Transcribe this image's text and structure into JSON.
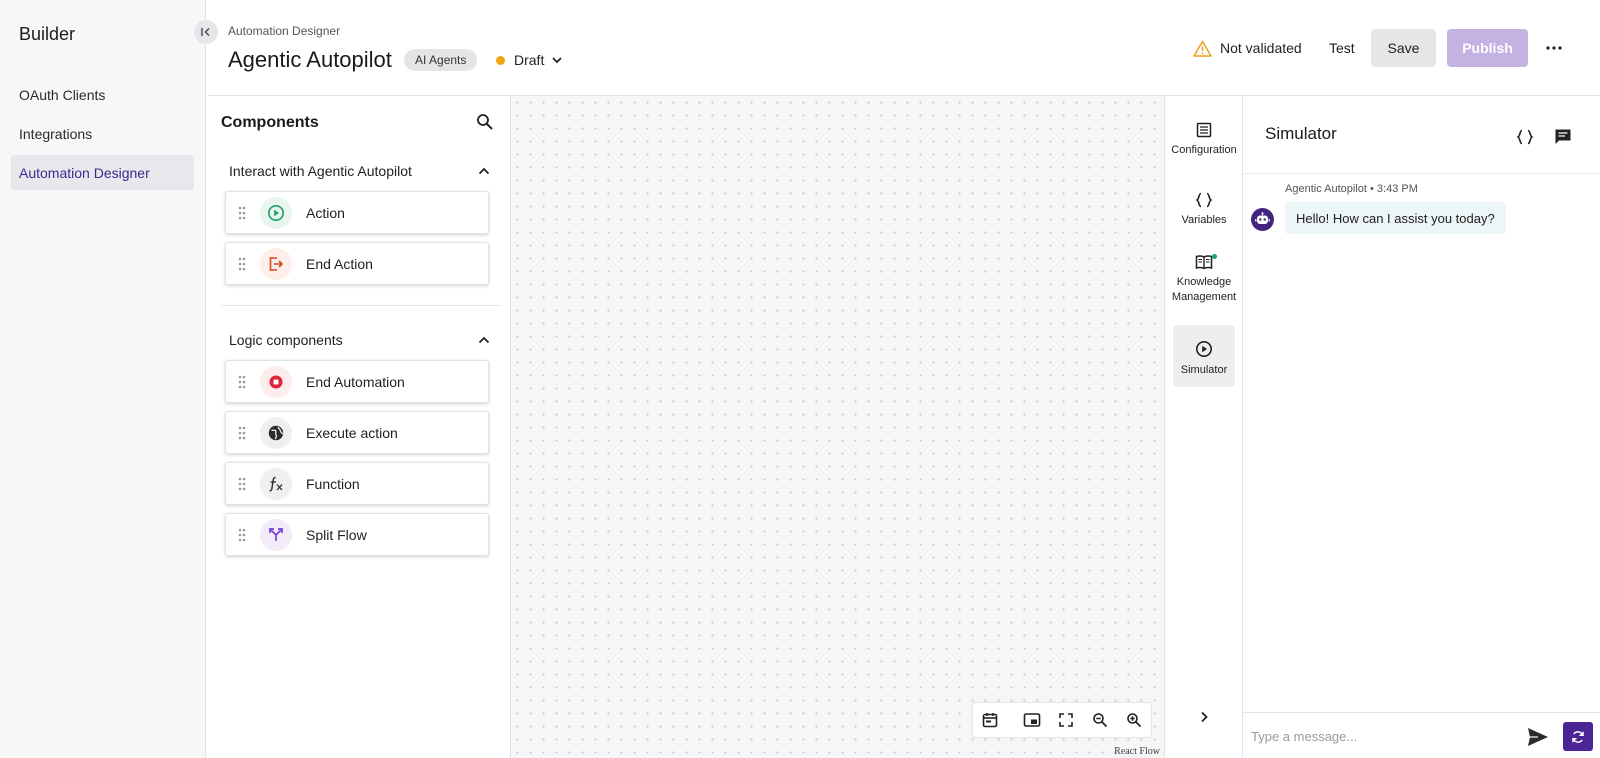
{
  "nav": {
    "title": "Builder",
    "items": [
      {
        "label": "OAuth Clients",
        "active": false
      },
      {
        "label": "Integrations",
        "active": false
      },
      {
        "label": "Automation Designer",
        "active": true
      }
    ]
  },
  "header": {
    "breadcrumb": "Automation Designer",
    "title": "Agentic Autopilot",
    "tag": "AI Agents",
    "status": "Draft",
    "status_color": "#f2a313",
    "validation": "Not validated",
    "test_label": "Test",
    "save_label": "Save",
    "publish_label": "Publish"
  },
  "components": {
    "title": "Components",
    "sections": [
      {
        "title": "Interact with Agentic Autopilot",
        "items": [
          {
            "label": "Action",
            "icon": "play-circle-icon"
          },
          {
            "label": "End Action",
            "icon": "exit-icon"
          }
        ]
      },
      {
        "title": "Logic components",
        "items": [
          {
            "label": "End Automation",
            "icon": "stop-circle-icon"
          },
          {
            "label": "Execute action",
            "icon": "globe-icon"
          },
          {
            "label": "Function",
            "icon": "function-icon"
          },
          {
            "label": "Split Flow",
            "icon": "split-icon"
          }
        ]
      }
    ]
  },
  "canvas": {
    "attribution": "React Flow"
  },
  "rail": {
    "items": [
      {
        "label": "Configuration",
        "icon": "list-icon"
      },
      {
        "label": "Variables",
        "icon": "braces-icon"
      },
      {
        "label": "Knowledge Management",
        "icon": "book-icon"
      },
      {
        "label": "Simulator",
        "icon": "play-circle-icon",
        "active": true
      }
    ]
  },
  "simulator": {
    "title": "Simulator",
    "message": {
      "sender": "Agentic Autopilot",
      "time": "3:43 PM",
      "meta": "Agentic Autopilot • 3:43 PM",
      "text": "Hello! How can I assist you today?"
    },
    "input_placeholder": "Type a message..."
  },
  "colors": {
    "accent": "#4b2496",
    "publish_disabled": "#c3b2e2",
    "nav_active_text": "#3b2a8f",
    "knowledge_dot": "#12a579"
  }
}
